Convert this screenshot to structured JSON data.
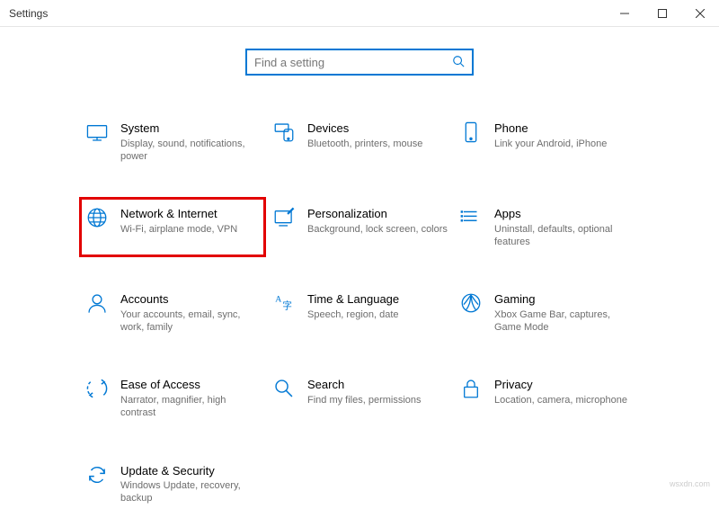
{
  "window": {
    "title": "Settings"
  },
  "search": {
    "placeholder": "Find a setting"
  },
  "tiles": [
    {
      "title": "System",
      "desc": "Display, sound, notifications, power"
    },
    {
      "title": "Devices",
      "desc": "Bluetooth, printers, mouse"
    },
    {
      "title": "Phone",
      "desc": "Link your Android, iPhone"
    },
    {
      "title": "Network & Internet",
      "desc": "Wi-Fi, airplane mode, VPN"
    },
    {
      "title": "Personalization",
      "desc": "Background, lock screen, colors"
    },
    {
      "title": "Apps",
      "desc": "Uninstall, defaults, optional features"
    },
    {
      "title": "Accounts",
      "desc": "Your accounts, email, sync, work, family"
    },
    {
      "title": "Time & Language",
      "desc": "Speech, region, date"
    },
    {
      "title": "Gaming",
      "desc": "Xbox Game Bar, captures, Game Mode"
    },
    {
      "title": "Ease of Access",
      "desc": "Narrator, magnifier, high contrast"
    },
    {
      "title": "Search",
      "desc": "Find my files, permissions"
    },
    {
      "title": "Privacy",
      "desc": "Location, camera, microphone"
    },
    {
      "title": "Update & Security",
      "desc": "Windows Update, recovery, backup"
    }
  ],
  "watermark": "wsxdn.com"
}
